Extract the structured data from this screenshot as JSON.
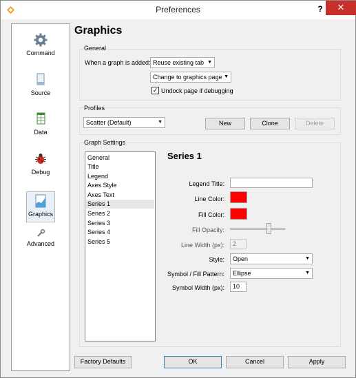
{
  "window": {
    "title": "Preferences",
    "help": "?",
    "close": "✕"
  },
  "sidebar": {
    "items": [
      {
        "label": "Command",
        "icon": "gear-icon"
      },
      {
        "label": "Source",
        "icon": "source-file-icon"
      },
      {
        "label": "Data",
        "icon": "data-table-icon"
      },
      {
        "label": "Debug",
        "icon": "bug-icon"
      },
      {
        "label": "Graphics",
        "icon": "graph-icon",
        "selected": true
      },
      {
        "label": "Advanced",
        "icon": "wrench-icon"
      }
    ]
  },
  "page": {
    "title": "Graphics"
  },
  "general": {
    "title": "General",
    "when_added_label": "When a graph is added:",
    "tab_option": "Reuse existing tab",
    "page_option": "Change to graphics page",
    "undock_label": "Undock page if debugging",
    "undock_checked": true,
    "check_mark": "✓"
  },
  "profiles": {
    "title": "Profiles",
    "selected": "Scatter (Default)",
    "new": "New",
    "clone": "Clone",
    "delete": "Delete"
  },
  "graph_settings": {
    "title": "Graph Settings",
    "items": [
      "General",
      "Title",
      "Legend",
      "Axes Style",
      "Axes Text",
      "Series 1",
      "Series 2",
      "Series 3",
      "Series 4",
      "Series 5"
    ],
    "selected_index": 5
  },
  "series": {
    "title": "Series 1",
    "legend_title_label": "Legend Title:",
    "legend_title_value": "",
    "line_color_label": "Line Color:",
    "line_color": "#ff0000",
    "fill_color_label": "Fill Color:",
    "fill_color": "#ff0000",
    "fill_opacity_label": "Fill Opacity:",
    "fill_opacity": 0.7,
    "line_width_label": "Line Width (px):",
    "line_width": "2",
    "style_label": "Style:",
    "style": "Open",
    "symbol_label": "Symbol / Fill Pattern:",
    "symbol": "Ellipse",
    "symbol_width_label": "Symbol Width (px):",
    "symbol_width": "10"
  },
  "footer": {
    "factory": "Factory Defaults",
    "ok": "OK",
    "cancel": "Cancel",
    "apply": "Apply"
  }
}
